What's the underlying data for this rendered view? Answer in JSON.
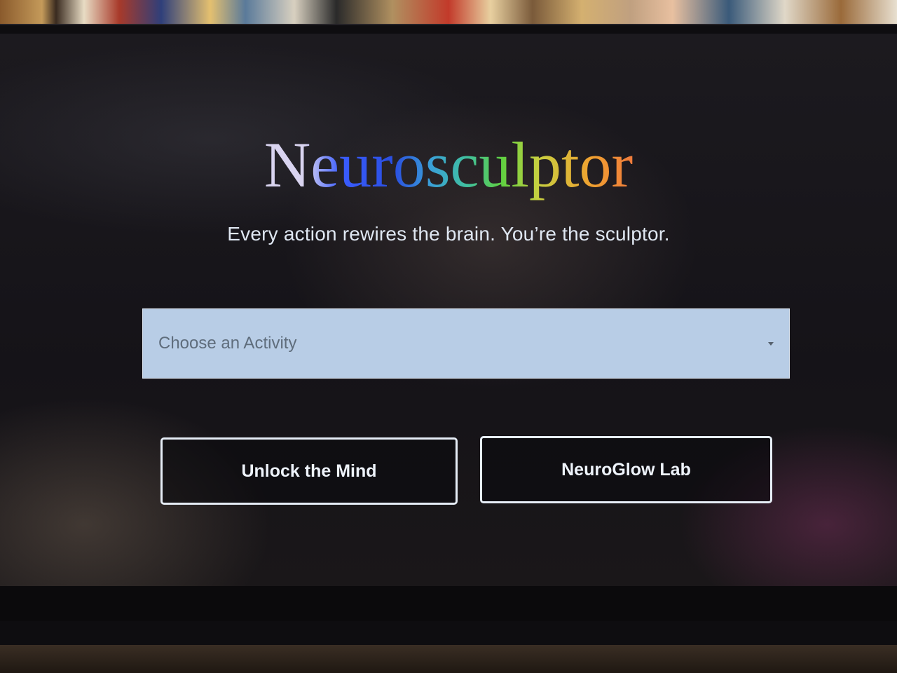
{
  "app": {
    "title": "Neurosculptor",
    "tagline": "Every action rewires the brain. You’re the sculptor."
  },
  "activity_select": {
    "placeholder": "Choose an Activity",
    "icon": "chevron-down-icon"
  },
  "buttons": {
    "unlock_label": "Unlock the Mind",
    "lab_label": "NeuroGlow Lab"
  },
  "colors": {
    "select_background": "#b8cde6",
    "button_border": "#e6edf6",
    "screen_background": "#151318"
  }
}
